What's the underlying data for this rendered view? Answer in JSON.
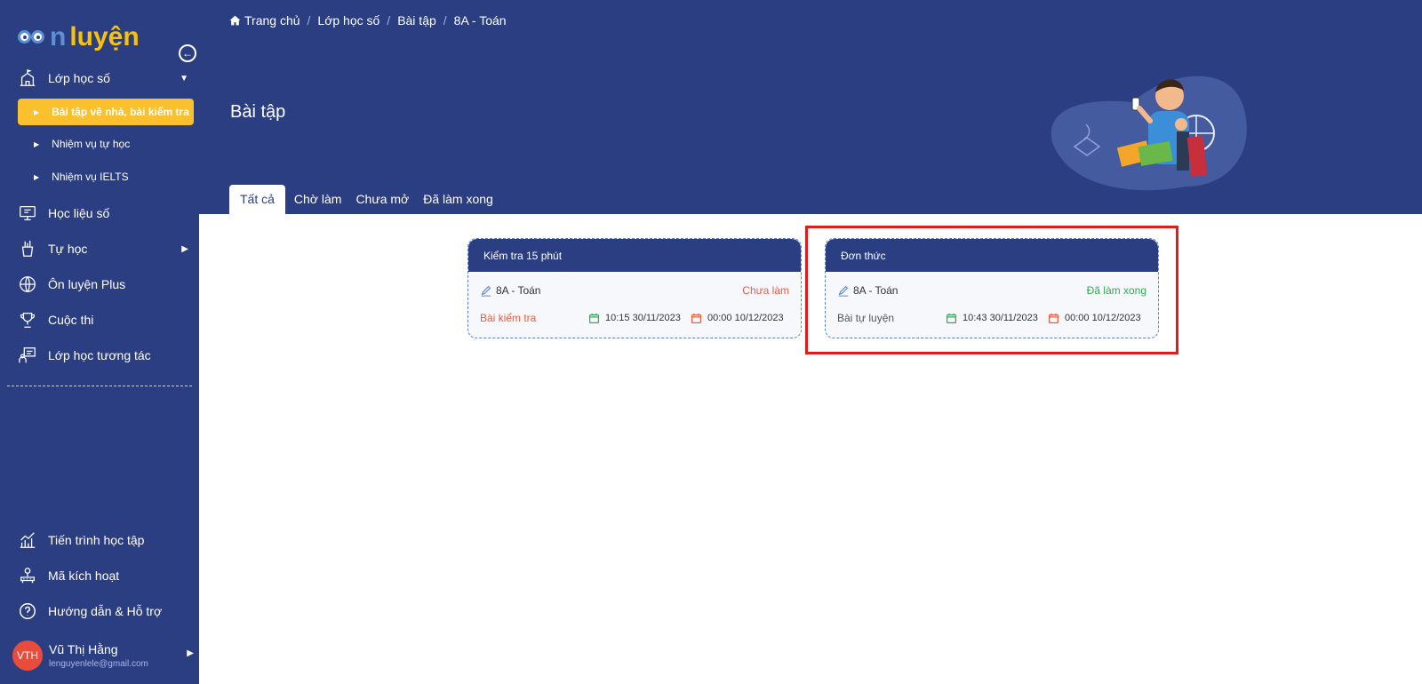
{
  "logo": {
    "part1": "n",
    "part2": "luyện"
  },
  "sidebar": {
    "items": [
      {
        "label": "Lớp học số",
        "icon": "school-icon"
      },
      {
        "label": "Học liệu số",
        "icon": "screen-book-icon"
      },
      {
        "label": "Tự học",
        "icon": "pencil-cup-icon"
      },
      {
        "label": "Ôn luyện Plus",
        "icon": "globe-icon"
      },
      {
        "label": "Cuộc thi",
        "icon": "trophy-icon"
      },
      {
        "label": "Lớp học tương tác",
        "icon": "interactive-class-icon"
      }
    ],
    "sub_items": [
      {
        "label": "Bài tập về nhà, bài kiểm tra"
      },
      {
        "label": "Nhiệm vụ tự học"
      },
      {
        "label": "Nhiệm vụ IELTS"
      }
    ],
    "bottom_items": [
      {
        "label": "Tiến trình học tập",
        "icon": "chart-icon"
      },
      {
        "label": "Mã kích hoạt",
        "icon": "key-code-icon"
      },
      {
        "label": "Hướng dẫn & Hỗ trợ",
        "icon": "help-icon"
      }
    ],
    "user": {
      "initials": "VTH",
      "name": "Vũ Thị Hằng",
      "email": "lenguyenlele@gmail.com"
    }
  },
  "breadcrumb": [
    "Trang chủ",
    "Lớp học số",
    "Bài tập",
    "8A - Toán"
  ],
  "page_title": "Bài tập",
  "tabs": [
    "Tất cả",
    "Chờ làm",
    "Chưa mở",
    "Đã làm xong"
  ],
  "cards": [
    {
      "title": "Kiểm tra 15 phút",
      "class": "8A - Toán",
      "status": "Chưa làm",
      "type": "Bài kiểm tra",
      "start": "10:15 30/11/2023",
      "end": "00:00 10/12/2023"
    },
    {
      "title": "Đơn thức",
      "class": "8A - Toán",
      "status": "Đã làm xong",
      "type": "Bài tự luyện",
      "start": "10:43 30/11/2023",
      "end": "00:00 10/12/2023"
    }
  ],
  "colors": {
    "primary": "#2c3e82",
    "accent": "#fbc02d",
    "todo": "#f05a3f",
    "done": "#35a853",
    "highlight": "#e01b1b"
  }
}
